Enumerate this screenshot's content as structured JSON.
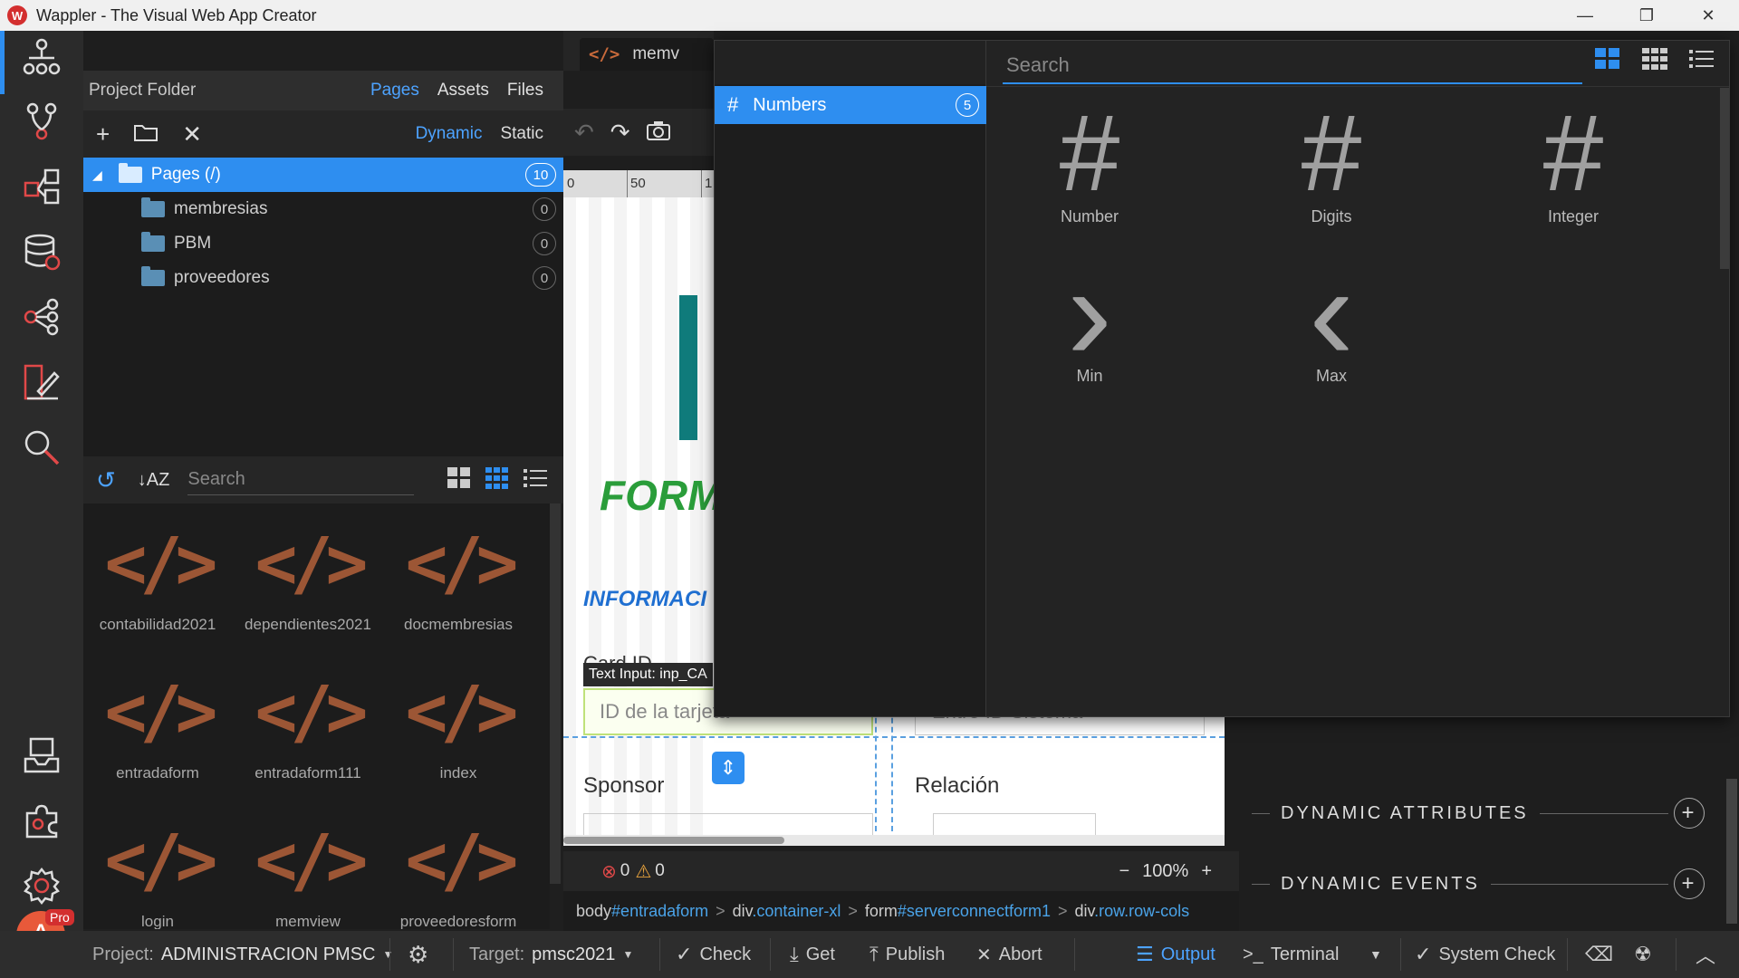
{
  "window": {
    "title": "Wappler - The Visual Web App Creator",
    "logo_text": "W",
    "controls": [
      "—",
      "❐",
      "✕"
    ]
  },
  "project_panel": {
    "title": "Project Folder",
    "tabs": [
      "Pages",
      "Assets",
      "Files"
    ],
    "active_tab": "Pages",
    "mode_tabs": [
      "Dynamic",
      "Static"
    ],
    "active_mode": "Dynamic",
    "tree": [
      {
        "label": "Pages (/)",
        "count": "10",
        "selected": true
      },
      {
        "label": "membresias",
        "count": "0"
      },
      {
        "label": "PBM",
        "count": "0"
      },
      {
        "label": "proveedores",
        "count": "0"
      }
    ],
    "assets_search_placeholder": "Search",
    "assets": [
      {
        "label": "contabilidad2021"
      },
      {
        "label": "dependientes2021"
      },
      {
        "label": "docmembresias"
      },
      {
        "label": "entradaform"
      },
      {
        "label": "entradaform111"
      },
      {
        "label": "index"
      },
      {
        "label": "login"
      },
      {
        "label": "memview"
      },
      {
        "label": "proveedoresform"
      }
    ]
  },
  "editor": {
    "tab_label": "memv",
    "ruler_ticks": [
      "0",
      "50",
      "1"
    ],
    "canvas": {
      "form_title": "FORM",
      "info_title": "INFORMACI",
      "card_label": "Card ID",
      "tooltip": "Text Input: inp_CA",
      "card_placeholder": "ID de la tarjeta",
      "sistema_placeholder": "Entre ID Sistema",
      "sponsor_label": "Sponsor",
      "relacion_label": "Relación"
    },
    "errors": "0",
    "warnings": "0",
    "zoom": "100%",
    "breadcrumb": [
      {
        "tag": "body",
        "attr": "#entradaform"
      },
      {
        "tag": "div",
        "attr": ".container-xl"
      },
      {
        "tag": "form",
        "attr": "#serverconnectform1"
      },
      {
        "tag": "div",
        "attr": ".row.row-cols"
      }
    ]
  },
  "picker": {
    "category": {
      "label": "Numbers",
      "count": "5"
    },
    "search_placeholder": "Search",
    "functions": [
      {
        "label": "Number",
        "glyph": "#"
      },
      {
        "label": "Digits",
        "glyph": "#"
      },
      {
        "label": "Integer",
        "glyph": "#"
      },
      {
        "label": "Min",
        "glyph": "›"
      },
      {
        "label": "Max",
        "glyph": "‹"
      }
    ]
  },
  "props_panel": {
    "sections": [
      "DYNAMIC ATTRIBUTES",
      "DYNAMIC EVENTS"
    ]
  },
  "bottombar": {
    "project_label": "Project:",
    "project_value": "ADMINISTRACION PMSC",
    "target_label": "Target:",
    "target_value": "pmsc2021",
    "check": "Check",
    "get": "Get",
    "publish": "Publish",
    "abort": "Abort",
    "output": "Output",
    "terminal": "Terminal",
    "system_check": "System Check",
    "avatar_letter": "A",
    "pro_badge": "Pro"
  },
  "colors": {
    "accent": "#2e8ef0",
    "code_icon": "#9c5635",
    "form_title": "#2a9d3a",
    "info_title": "#1f6fd1"
  }
}
